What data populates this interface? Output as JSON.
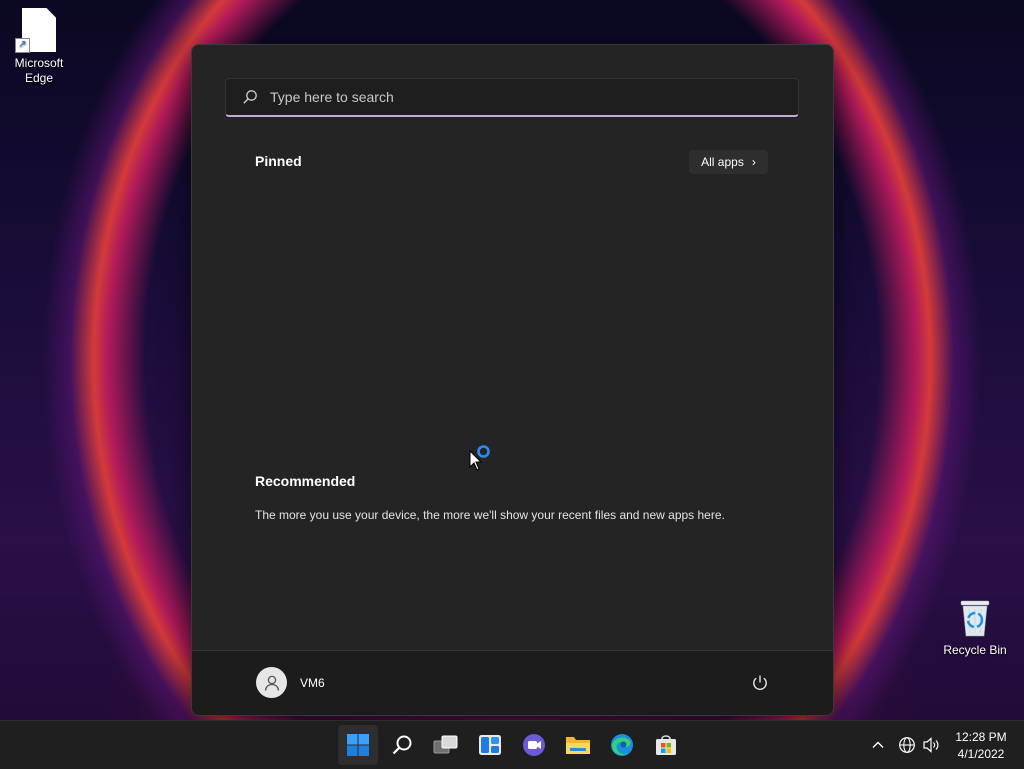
{
  "desktop": {
    "icons": [
      {
        "label": "Microsoft\nEdge",
        "line1": "Microsoft",
        "line2": "Edge"
      },
      {
        "label": "Recycle Bin"
      }
    ]
  },
  "start_menu": {
    "search": {
      "placeholder": "Type here to search",
      "value": ""
    },
    "pinned": {
      "title": "Pinned",
      "all_apps_label": "All apps"
    },
    "recommended": {
      "title": "Recommended",
      "empty_message": "The more you use your device, the more we'll show your recent files and new apps here."
    },
    "user": {
      "name": "VM6"
    }
  },
  "taskbar": {
    "apps": [
      "start-icon",
      "search-icon",
      "task-view-icon",
      "widgets-icon",
      "chat-icon",
      "file-explorer-icon",
      "edge-icon",
      "store-icon"
    ],
    "tray": [
      "chevron-up-icon",
      "network-icon",
      "volume-icon"
    ],
    "clock": {
      "time": "12:28 PM",
      "date": "4/1/2022"
    }
  },
  "colors": {
    "accent": "#c6a7d6",
    "start_bg": "#242424",
    "taskbar_bg": "#1f1f1f"
  }
}
